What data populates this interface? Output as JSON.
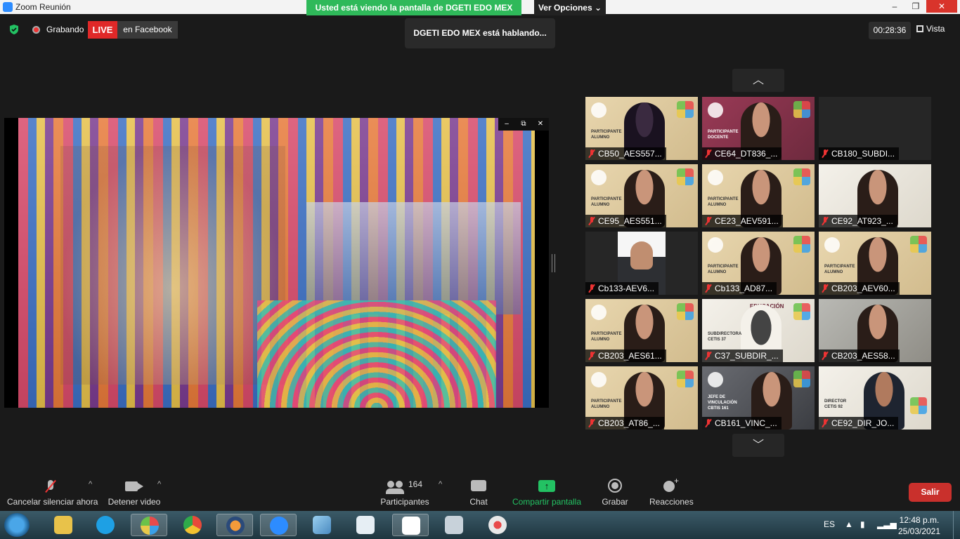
{
  "window": {
    "title": "Zoom Reunión",
    "min": "–",
    "max": "❐",
    "close": "✕"
  },
  "share_banner": "Usted está viendo la pantalla de  DGETI EDO MEX",
  "view_options": "Ver Opciones ⌄",
  "status": {
    "recording": "Grabando",
    "live": "LIVE",
    "live_target": "en Facebook",
    "talking": "DGETI EDO MEX está hablando...",
    "timer": "00:28:36",
    "view": "Vista"
  },
  "shared_screen": {
    "controls": [
      "–",
      "⧉",
      "✕"
    ]
  },
  "gallery": {
    "up": "︿",
    "down": "﹀",
    "tiles": [
      {
        "name": "CB50_AES557...",
        "role": "PARTICIPANTE\nALUMNO"
      },
      {
        "name": "CE64_DT836_...",
        "role": "PARTICIPANTE\nDOCENTE"
      },
      {
        "name": "CB180_SUBDI...",
        "role": ""
      },
      {
        "name": "CE95_AES551...",
        "role": "PARTICIPANTE\nALUMNO"
      },
      {
        "name": "CE23_AEV591...",
        "role": "PARTICIPANTE\nALUMNO"
      },
      {
        "name": "CE92_AT923_...",
        "role": ""
      },
      {
        "name": "Cb133-AEV6...",
        "role": ""
      },
      {
        "name": "Cb133_AD87...",
        "role": "PARTICIPANTE\nALUMNO"
      },
      {
        "name": "CB203_AEV60...",
        "role": "PARTICIPANTE\nALUMNO"
      },
      {
        "name": "CB203_AES61...",
        "role": "PARTICIPANTE\nALUMNO"
      },
      {
        "name": "C37_SUBDIR_...",
        "role": "SUBDIRECTORA\nCETIS 37"
      },
      {
        "name": "CB203_AES58...",
        "role": ""
      },
      {
        "name": "CB203_AT86_...",
        "role": "PARTICIPANTE\nALUMNO"
      },
      {
        "name": "CB161_VINC_...",
        "role": "JEFE DE\nVINCULACIÓN\nCBTIS 161"
      },
      {
        "name": "CE92_DIR_JO...",
        "role": "DIRECTOR\nCETIS 92"
      }
    ],
    "tile_c37_header": "EDUCACIÓN"
  },
  "toolbar": {
    "mute": "Cancelar silenciar ahora",
    "video": "Detener video",
    "participants": "Participantes",
    "participants_count": "164",
    "chat": "Chat",
    "share": "Compartir pantalla",
    "record": "Grabar",
    "reactions": "Reacciones",
    "leave": "Salir",
    "caret": "^"
  },
  "taskbar": {
    "lang": "ES",
    "time": "12:48 p.m.",
    "date": "25/03/2021"
  },
  "colors": {
    "accent_green": "#23c263",
    "banner_green": "#2fb95a",
    "live_red": "#e02828",
    "leave_red": "#c9302c"
  }
}
